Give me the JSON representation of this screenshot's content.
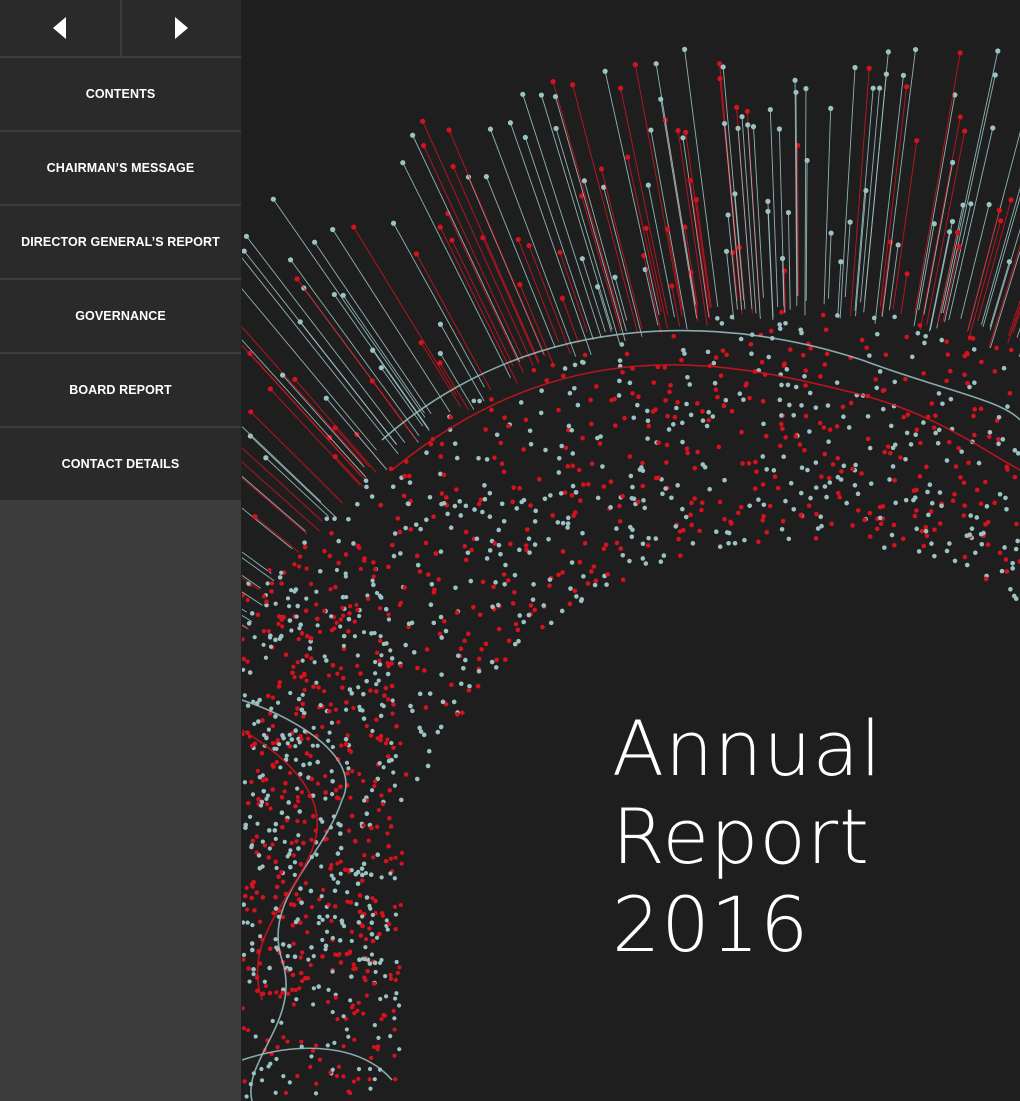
{
  "nav": {
    "prev_icon": "triangle-left-icon",
    "next_icon": "triangle-right-icon",
    "items": [
      {
        "label": "CONTENTS"
      },
      {
        "label": "CHAIRMAN’S MESSAGE"
      },
      {
        "label": "DIRECTOR GENERAL’S REPORT"
      },
      {
        "label": "GOVERNANCE"
      },
      {
        "label": "BOARD REPORT"
      },
      {
        "label": "CONTACT DETAILS"
      }
    ]
  },
  "cover": {
    "title_line1": "Annual",
    "title_line2": "Report",
    "title_line3": "2016"
  },
  "colors": {
    "background": "#1e1e1e",
    "sidebar": "#3c3c3c",
    "button": "#2a2a2a",
    "accent_red": "#d6121f",
    "accent_teal": "#9cc3c4"
  }
}
